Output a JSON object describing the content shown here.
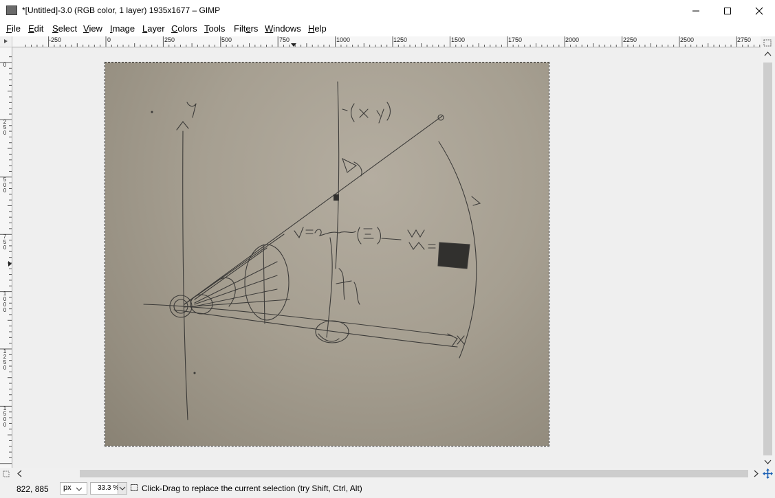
{
  "window": {
    "title": "*[Untitled]-3.0 (RGB color, 1 layer) 1935x1677 – GIMP",
    "controls": [
      "minimize-icon",
      "maximize-icon",
      "close-icon"
    ]
  },
  "menu": [
    {
      "label": "File"
    },
    {
      "label": "Edit"
    },
    {
      "label": "Select"
    },
    {
      "label": "View"
    },
    {
      "label": "Image"
    },
    {
      "label": "Layer"
    },
    {
      "label": "Colors"
    },
    {
      "label": "Tools"
    },
    {
      "label": "Filters"
    },
    {
      "label": "Windows"
    },
    {
      "label": "Help"
    }
  ],
  "hruler_labels": [
    "-250",
    "0",
    "250",
    "500",
    "750",
    "1000",
    "1250",
    "1500",
    "1750",
    "2000",
    "2250",
    "2500",
    "2750"
  ],
  "vruler_labels": [
    "0",
    "250",
    "500",
    "750",
    "1000",
    "1250",
    "1500"
  ],
  "canvas": {
    "image_description_icon": "hand-drawn-sketch-image",
    "sketch_text": {
      "y_axis": "y",
      "point": "(x, y)",
      "formula": "V = 2atan2( w/2 )",
      "right": "W",
      "m_label": "M",
      "x_axis": "x",
      "f_label": "f"
    }
  },
  "statusbar": {
    "coords": "822, 885",
    "unit": "px",
    "zoom": "33.3 %",
    "message": "Click-Drag to replace the current selection (try Shift, Ctrl, Alt)"
  },
  "colors": {
    "canvas_bg": "#efefef",
    "image_paper": "#a69f91",
    "ink": "#2a2a2a"
  }
}
